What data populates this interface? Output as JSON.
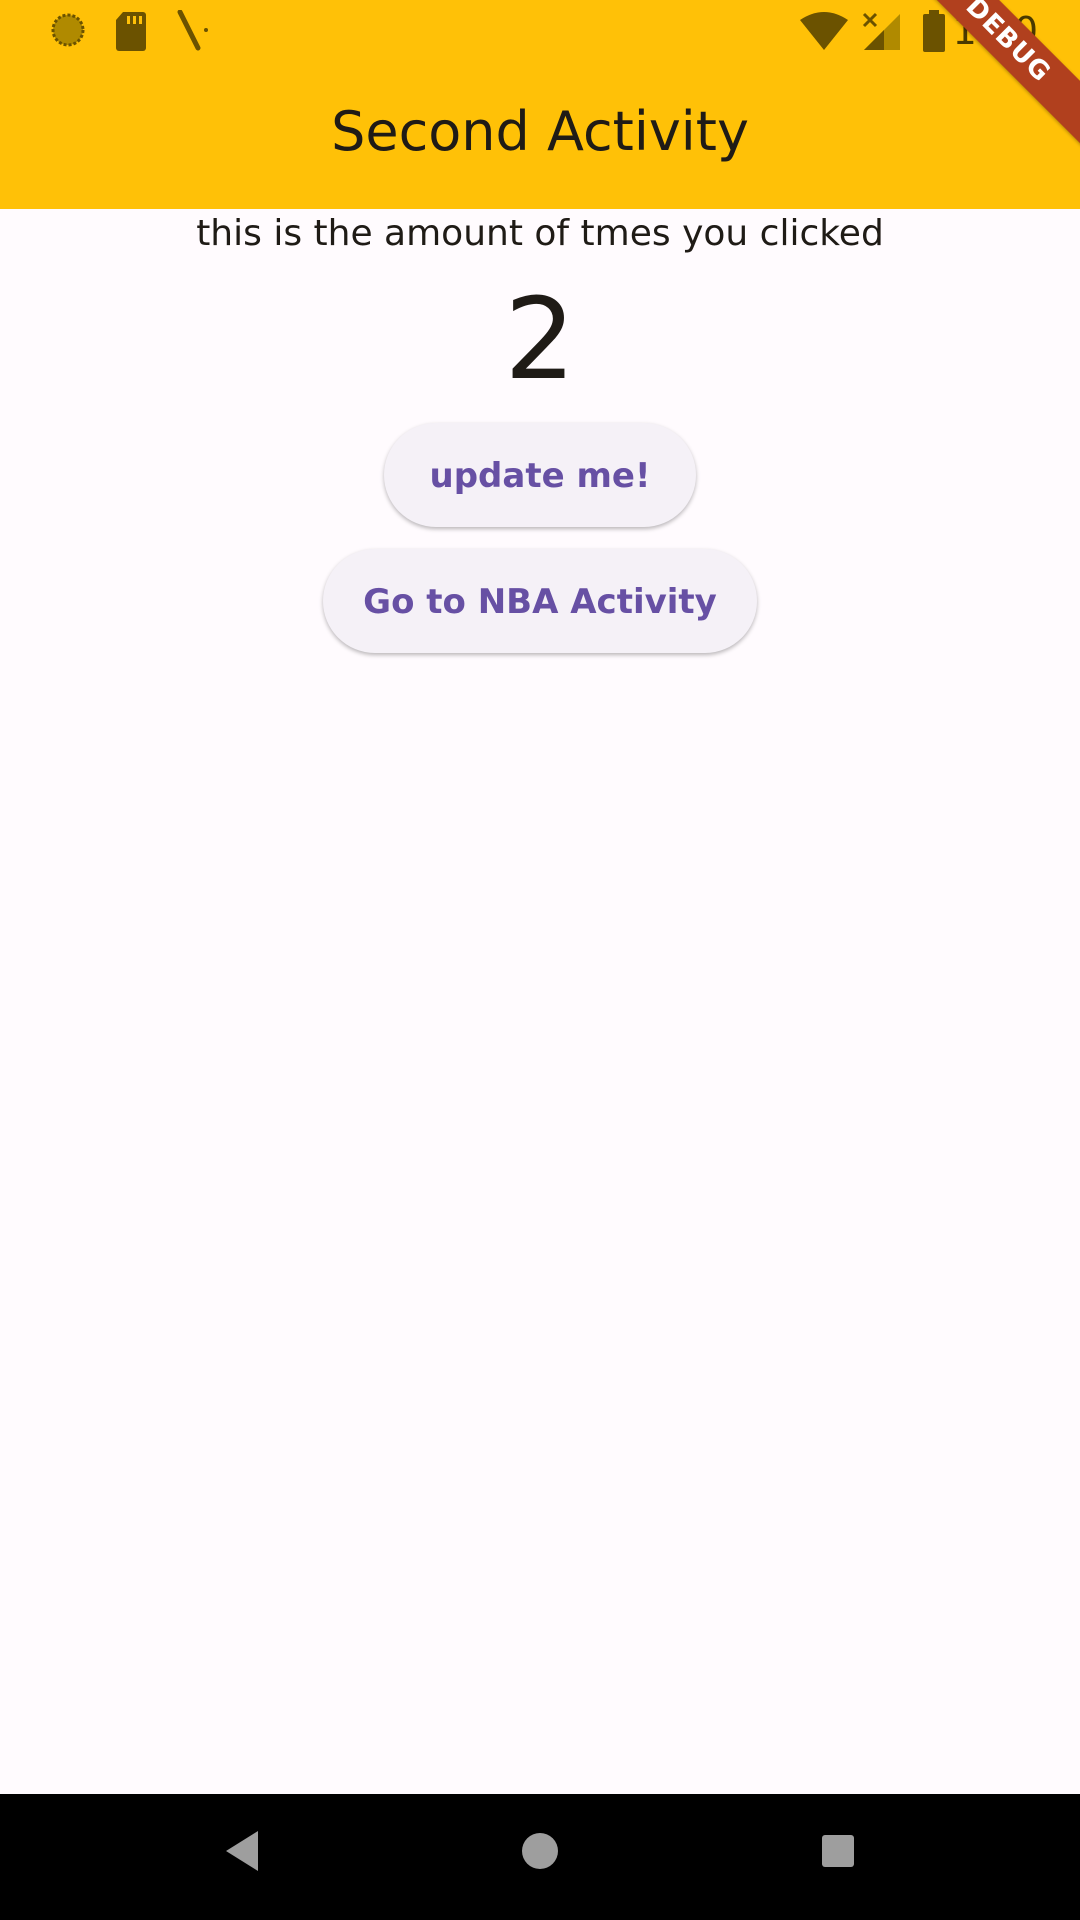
{
  "status_bar": {
    "time": "1:00",
    "left_icons": [
      "sun-icon",
      "sd-card-icon",
      "screwdriver-icon"
    ],
    "right_icons": [
      "wifi-icon",
      "signal-icon",
      "battery-icon"
    ]
  },
  "app_bar": {
    "title": "Second Activity",
    "background": "#ffc107"
  },
  "debug_banner": "DEBUG",
  "main": {
    "label": "this is the amount of tmes you clicked",
    "count": "2",
    "update_button": "update me!",
    "nba_button": "Go to NBA Activity"
  },
  "colors": {
    "accent": "#6750a4",
    "button_bg": "#f5f1f7",
    "page_bg": "#fffbfe"
  },
  "nav_bar": {
    "buttons": [
      "back-icon",
      "home-icon",
      "recents-icon"
    ]
  }
}
